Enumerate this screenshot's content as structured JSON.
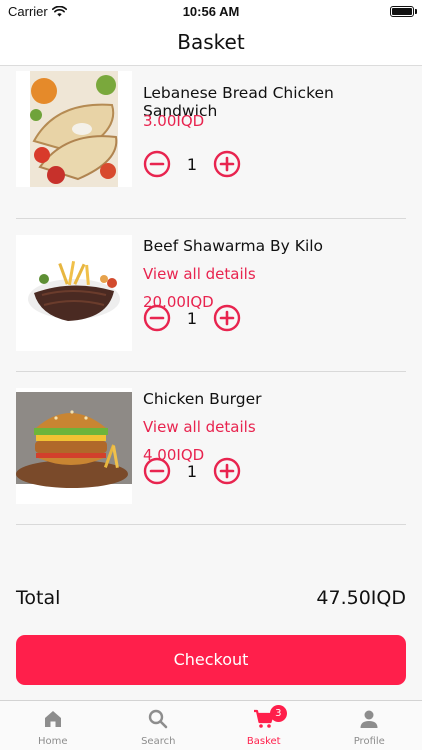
{
  "status_bar": {
    "carrier": "Carrier",
    "time": "10:56 AM"
  },
  "header": {
    "title": "Basket"
  },
  "items": [
    {
      "name": "Lebanese Bread Chicken Sandwich",
      "details_label": "",
      "price": "3.00IQD",
      "quantity": "1",
      "image": "chicken-wrap-image"
    },
    {
      "name": "Beef Shawarma By Kilo",
      "details_label": "View all details",
      "price": "20.00IQD",
      "quantity": "1",
      "image": "beef-shawarma-image"
    },
    {
      "name": "Chicken Burger",
      "details_label": "View all details",
      "price": "4.00IQD",
      "quantity": "1",
      "image": "chicken-burger-image"
    }
  ],
  "summary": {
    "total_label": "Total",
    "total_value": "47.50IQD"
  },
  "checkout": {
    "label": "Checkout"
  },
  "tab_bar": {
    "tabs": [
      {
        "label": "Home",
        "icon": "home-icon"
      },
      {
        "label": "Search",
        "icon": "search-icon"
      },
      {
        "label": "Basket",
        "icon": "cart-icon",
        "badge": "3"
      },
      {
        "label": "Profile",
        "icon": "person-icon"
      }
    ],
    "active": "Basket"
  },
  "colors": {
    "accent": "#ff1f4b",
    "price": "#e8244f",
    "inactive": "#8d8d8d"
  }
}
